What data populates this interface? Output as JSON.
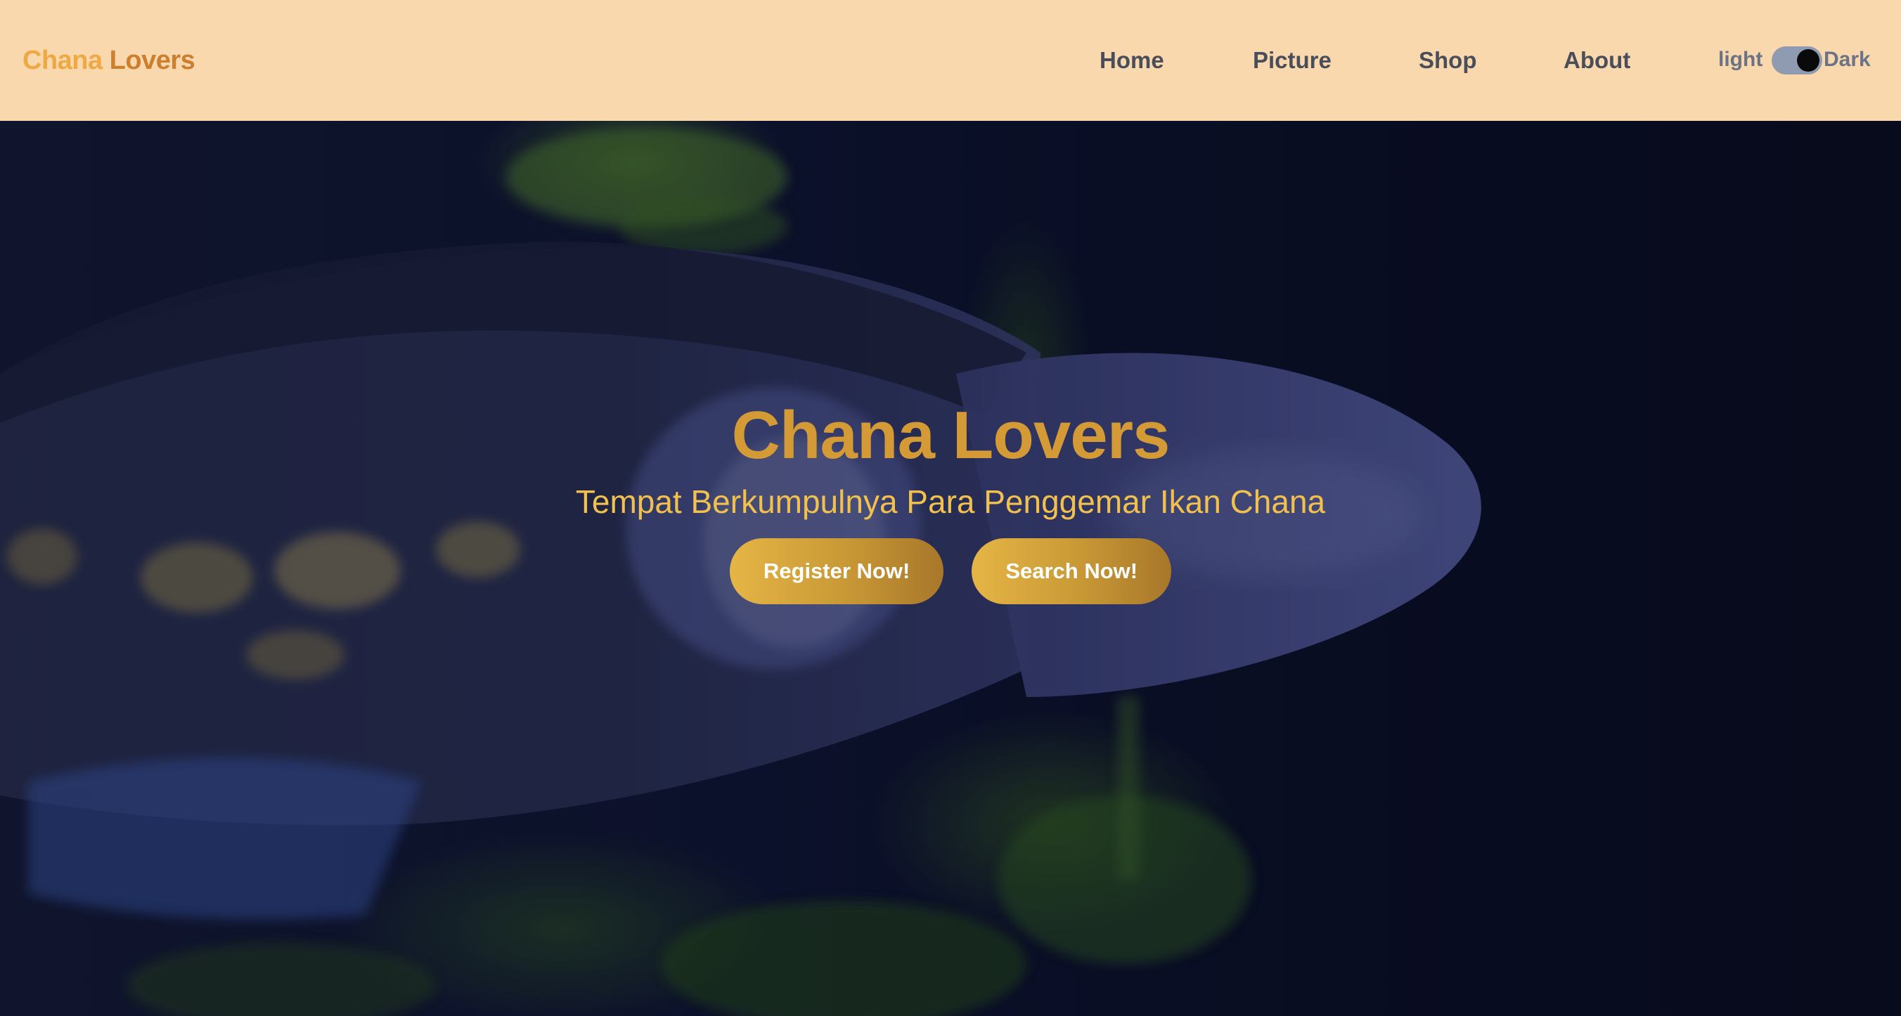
{
  "navbar": {
    "brand_first": "Chana",
    "brand_second": "Lovers",
    "links": [
      "Home",
      "Picture",
      "Shop",
      "About"
    ],
    "theme_light": "light",
    "theme_dark": "Dark",
    "theme_state": "dark"
  },
  "hero": {
    "title": "Chana Lovers",
    "subtitle": "Tempat Berkumpulnya Para Penggemar Ikan Chana",
    "register_button": "Register Now!",
    "search_button": "Search Now!"
  },
  "colors": {
    "navbar_bg": "#f9d8ae",
    "brand_accent": "#eea944",
    "title_gold": "#d39a35",
    "subtitle_gold": "#f2c14d",
    "button_gold": "#c89836",
    "hero_bg": "#0b0f22"
  }
}
